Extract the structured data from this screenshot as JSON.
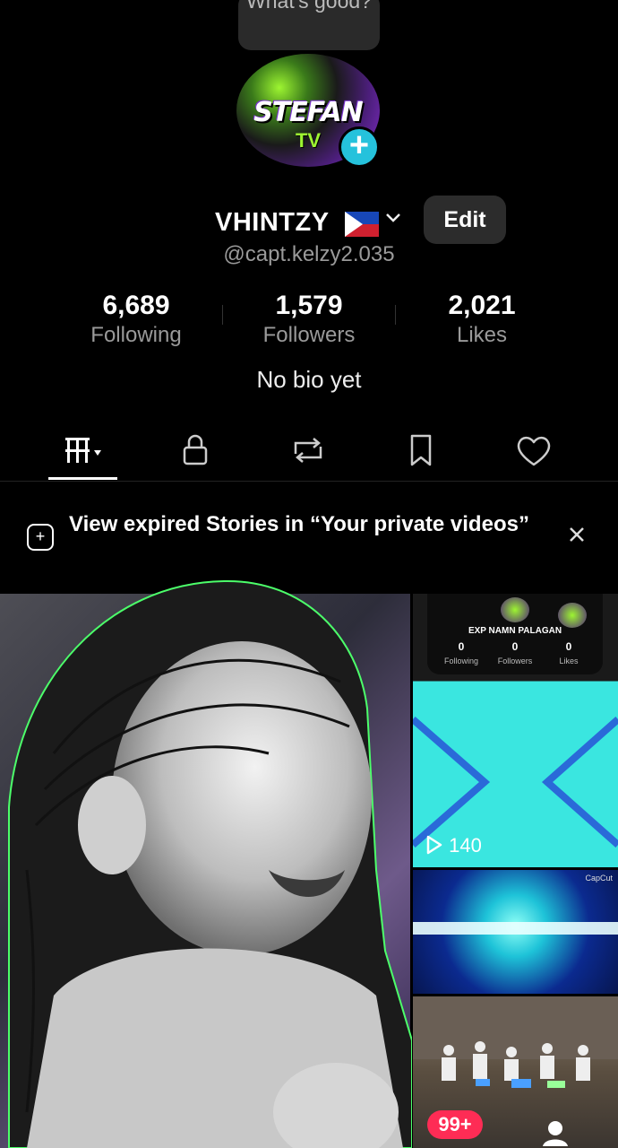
{
  "bubble": {
    "text": "What's good?"
  },
  "avatar": {
    "logo_text": "STEFAN",
    "logo_sub": "TV"
  },
  "profile": {
    "display_name": "VHINTZY",
    "handle": "@capt.kelzy2.035",
    "edit_label": "Edit",
    "bio": "No bio yet"
  },
  "stats": [
    {
      "value": "6,689",
      "label": "Following"
    },
    {
      "value": "1,579",
      "label": "Followers"
    },
    {
      "value": "2,021",
      "label": "Likes"
    }
  ],
  "tabs": [
    {
      "name": "videos-grid",
      "icon": "grid-icon"
    },
    {
      "name": "private",
      "icon": "lock-icon"
    },
    {
      "name": "reposts",
      "icon": "repost-icon"
    },
    {
      "name": "favorites",
      "icon": "bookmark-icon"
    },
    {
      "name": "liked",
      "icon": "heart-icon"
    }
  ],
  "banner": {
    "text": "View expired Stories in “Your private videos”"
  },
  "grid": {
    "card_name": "EXP NAMN PALAGAN",
    "card_stats": [
      {
        "value": "0",
        "label": "Following"
      },
      {
        "value": "0",
        "label": "Followers"
      },
      {
        "value": "0",
        "label": "Likes"
      }
    ],
    "views": "140",
    "capcut": "CapCut"
  },
  "nav": {
    "inbox_badge": "99+"
  },
  "colors": {
    "accent": "#fe2c55",
    "plus": "#25c2dc",
    "bg": "#000000"
  }
}
